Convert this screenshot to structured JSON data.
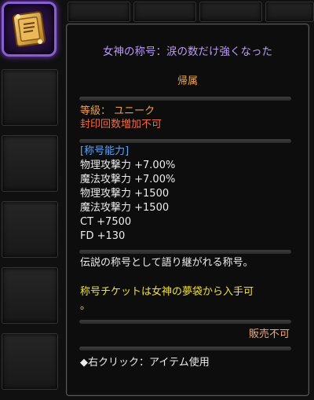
{
  "tooltip": {
    "title": "女神の称号：涙の数だけ強くなった",
    "belong": "帰属",
    "grade": "等級： ユニーク",
    "seal": "封印回数増加不可",
    "ability_header": "[称号能力]",
    "abilities": [
      "物理攻撃力 +7.00%",
      "魔法攻撃力 +7.00%",
      "物理攻撃力 +1500",
      "魔法攻撃力 +1500",
      "CT +7500",
      "FD +130"
    ],
    "description": "伝説の称号として語り継がれる称号。",
    "ticket_line1": "称号チケットは女神の夢袋から入手可",
    "ticket_line2": "。",
    "not_for_sale": "販売不可",
    "right_click": "◆右クリック：アイテム使用"
  },
  "colors": {
    "title": "#b79cf6",
    "belong": "#f0a24a",
    "grade": "#f0a24a",
    "seal": "#f06a4a",
    "ability_header": "#5fa6f5",
    "ticket": "#f2e03a",
    "not_for_sale": "#f0a877",
    "icon_border": "#8b5cd6"
  },
  "item_icon": "title-scroll-icon"
}
